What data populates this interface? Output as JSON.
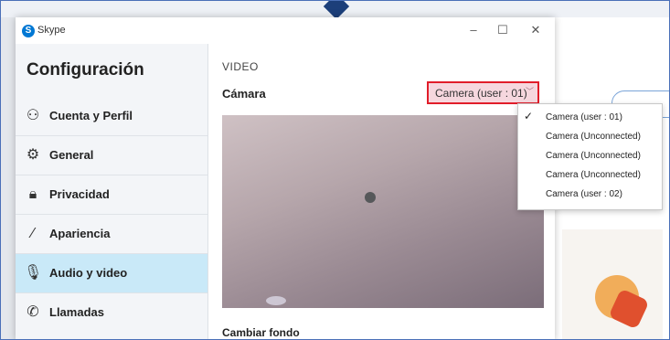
{
  "window": {
    "app_title": "Skype",
    "minimize": "–",
    "maximize": "☐",
    "close": "✕"
  },
  "sidebar": {
    "heading": "Configuración",
    "items": [
      {
        "label": "Cuenta y Perfil",
        "icon": "person-icon",
        "glyph": "⚇"
      },
      {
        "label": "General",
        "icon": "gear-icon",
        "glyph": "⚙"
      },
      {
        "label": "Privacidad",
        "icon": "lock-icon",
        "glyph": "🔒︎"
      },
      {
        "label": "Apariencia",
        "icon": "magic-wand-icon",
        "glyph": "⁄"
      },
      {
        "label": "Audio y video",
        "icon": "microphone-icon",
        "glyph": "🎙︎",
        "active": true
      },
      {
        "label": "Llamadas",
        "icon": "phone-icon",
        "glyph": "✆"
      }
    ]
  },
  "content": {
    "section": "VIDEO",
    "camera_label": "Cámara",
    "camera_selected": "Camera (user : 01)",
    "background_label": "Cambiar fondo"
  },
  "dropdown": {
    "options": [
      {
        "label": "Camera (user : 01)",
        "checked": true
      },
      {
        "label": "Camera (Unconnected)",
        "checked": false
      },
      {
        "label": "Camera (Unconnected)",
        "checked": false
      },
      {
        "label": "Camera (Unconnected)",
        "checked": false
      },
      {
        "label": "Camera (user : 02)",
        "checked": false
      }
    ]
  },
  "colors": {
    "accent": "#c9e9f8",
    "highlight_border": "#e11d2a",
    "skype_blue": "#0078d4"
  }
}
